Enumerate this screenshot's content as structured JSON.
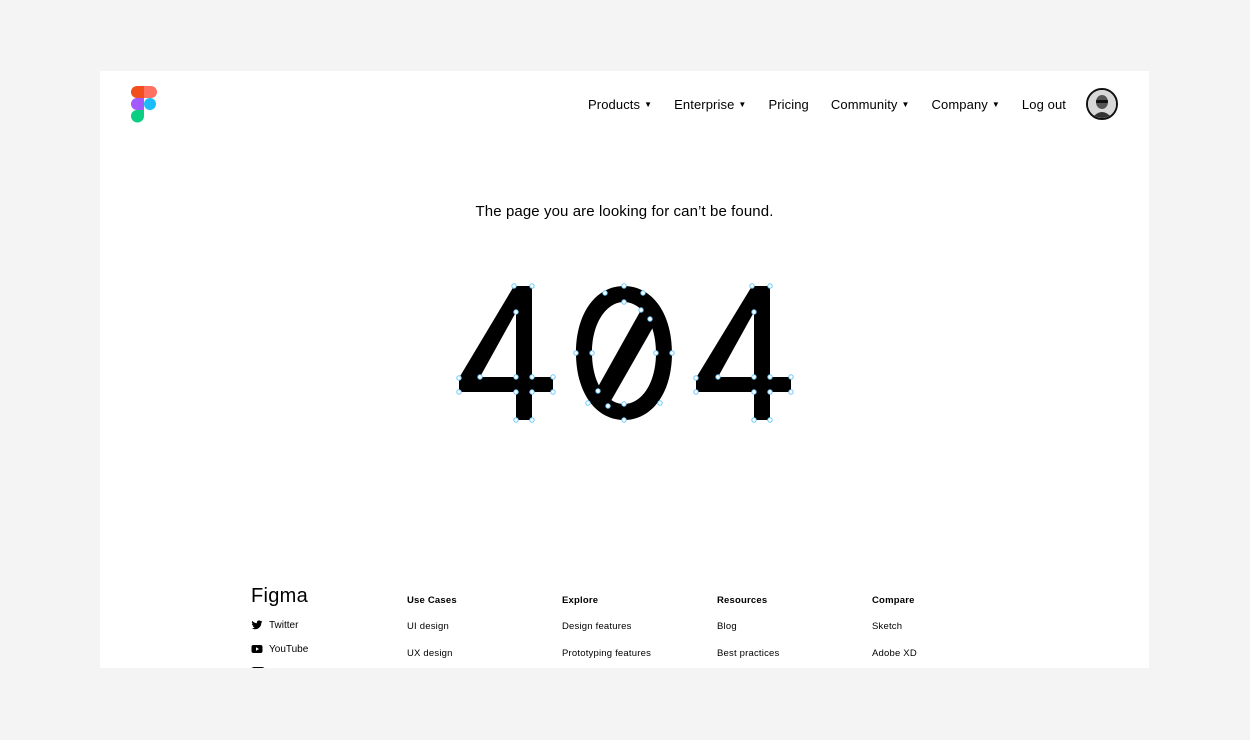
{
  "nav": {
    "products": "Products",
    "enterprise": "Enterprise",
    "pricing": "Pricing",
    "community": "Community",
    "company": "Company",
    "logout": "Log out",
    "caret": "▼"
  },
  "message": "The page you are looking for can’t be found.",
  "error_code": "404",
  "footer": {
    "brand": "Figma",
    "social": [
      "Twitter",
      "YouTube"
    ],
    "columns": [
      {
        "heading": "Use Cases",
        "links": [
          "UI design",
          "UX design"
        ]
      },
      {
        "heading": "Explore",
        "links": [
          "Design features",
          "Prototyping features"
        ]
      },
      {
        "heading": "Resources",
        "links": [
          "Blog",
          "Best practices"
        ]
      },
      {
        "heading": "Compare",
        "links": [
          "Sketch",
          "Adobe XD"
        ]
      }
    ]
  },
  "colors": {
    "logo_red": "#f24e1e",
    "logo_orange": "#ff7262",
    "logo_purple": "#a259ff",
    "logo_blue": "#1abcfe",
    "logo_green": "#0acf83",
    "anchor_blue": "#6cc7f5"
  }
}
